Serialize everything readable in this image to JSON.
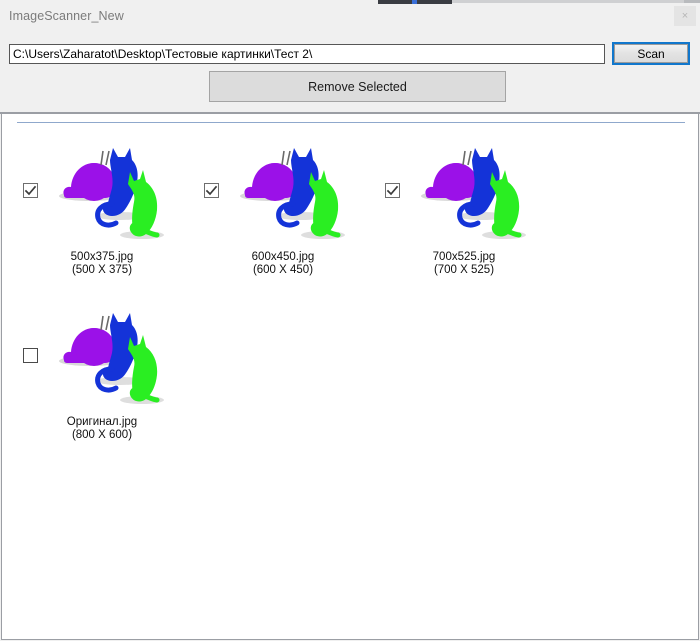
{
  "window": {
    "title": "ImageScanner_New",
    "close_label": "×",
    "close_icon": "close-icon"
  },
  "toolbar": {
    "path_value": "C:\\Users\\Zaharatot\\Desktop\\Тестовые картинки\\Тест 2\\",
    "path_placeholder": "",
    "scan_label": "Scan",
    "remove_selected_label": "Remove Selected"
  },
  "theme": {
    "window_bg": "#f0f0f0",
    "panel_bg": "#ffffff",
    "border": "#9b9ea4",
    "focus_accent": "#1177cc",
    "rule_blue": "#8fa8cc",
    "art_purple": "#9b11e8",
    "art_blue": "#1433d8",
    "art_green": "#2aee22"
  },
  "thumbnails": {
    "items": [
      {
        "name": "500x375.jpg",
        "dimensions": "(500 X 375)",
        "checked": true,
        "icon": "image-thumbnail-icon"
      },
      {
        "name": "600x450.jpg",
        "dimensions": "(600 X 450)",
        "checked": true,
        "icon": "image-thumbnail-icon"
      },
      {
        "name": "700x525.jpg",
        "dimensions": "(700 X 525)",
        "checked": true,
        "icon": "image-thumbnail-icon"
      },
      {
        "name": "Оригинал.jpg",
        "dimensions": "(800 X 600)",
        "checked": false,
        "icon": "image-thumbnail-icon"
      }
    ]
  }
}
